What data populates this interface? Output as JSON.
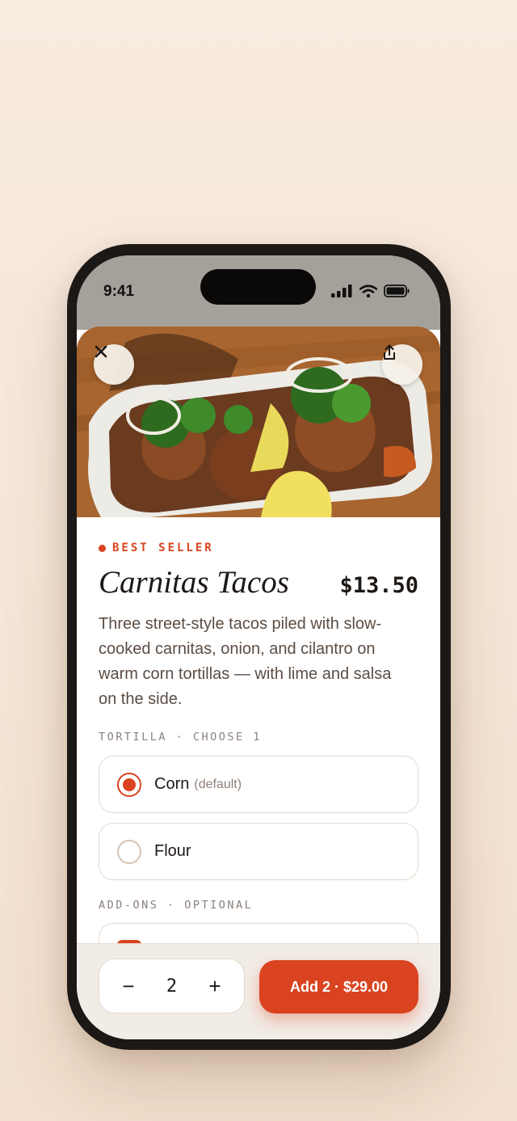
{
  "status": {
    "time": "9:41"
  },
  "item": {
    "badge": "BEST SELLER",
    "title": "Carnitas Tacos",
    "price": "$13.50",
    "description": "Three street-style tacos piled with slow-cooked carnitas, onion, and cilantro on warm corn tortillas — with lime and salsa on the side."
  },
  "tortilla": {
    "label": "TORTILLA · CHOOSE 1",
    "options": [
      {
        "label": "Corn",
        "hint": "(default)",
        "selected": true
      },
      {
        "label": "Flour",
        "hint": "",
        "selected": false
      }
    ]
  },
  "addons": {
    "label": "ADD-ONS · OPTIONAL"
  },
  "cart": {
    "quantity": "2",
    "minus": "−",
    "plus": "+",
    "add_label": "Add 2 · $29.00"
  },
  "icons": {
    "close": "close-icon",
    "share": "share-icon"
  },
  "colors": {
    "accent": "#d9431f",
    "background": "#f8ebe0"
  }
}
